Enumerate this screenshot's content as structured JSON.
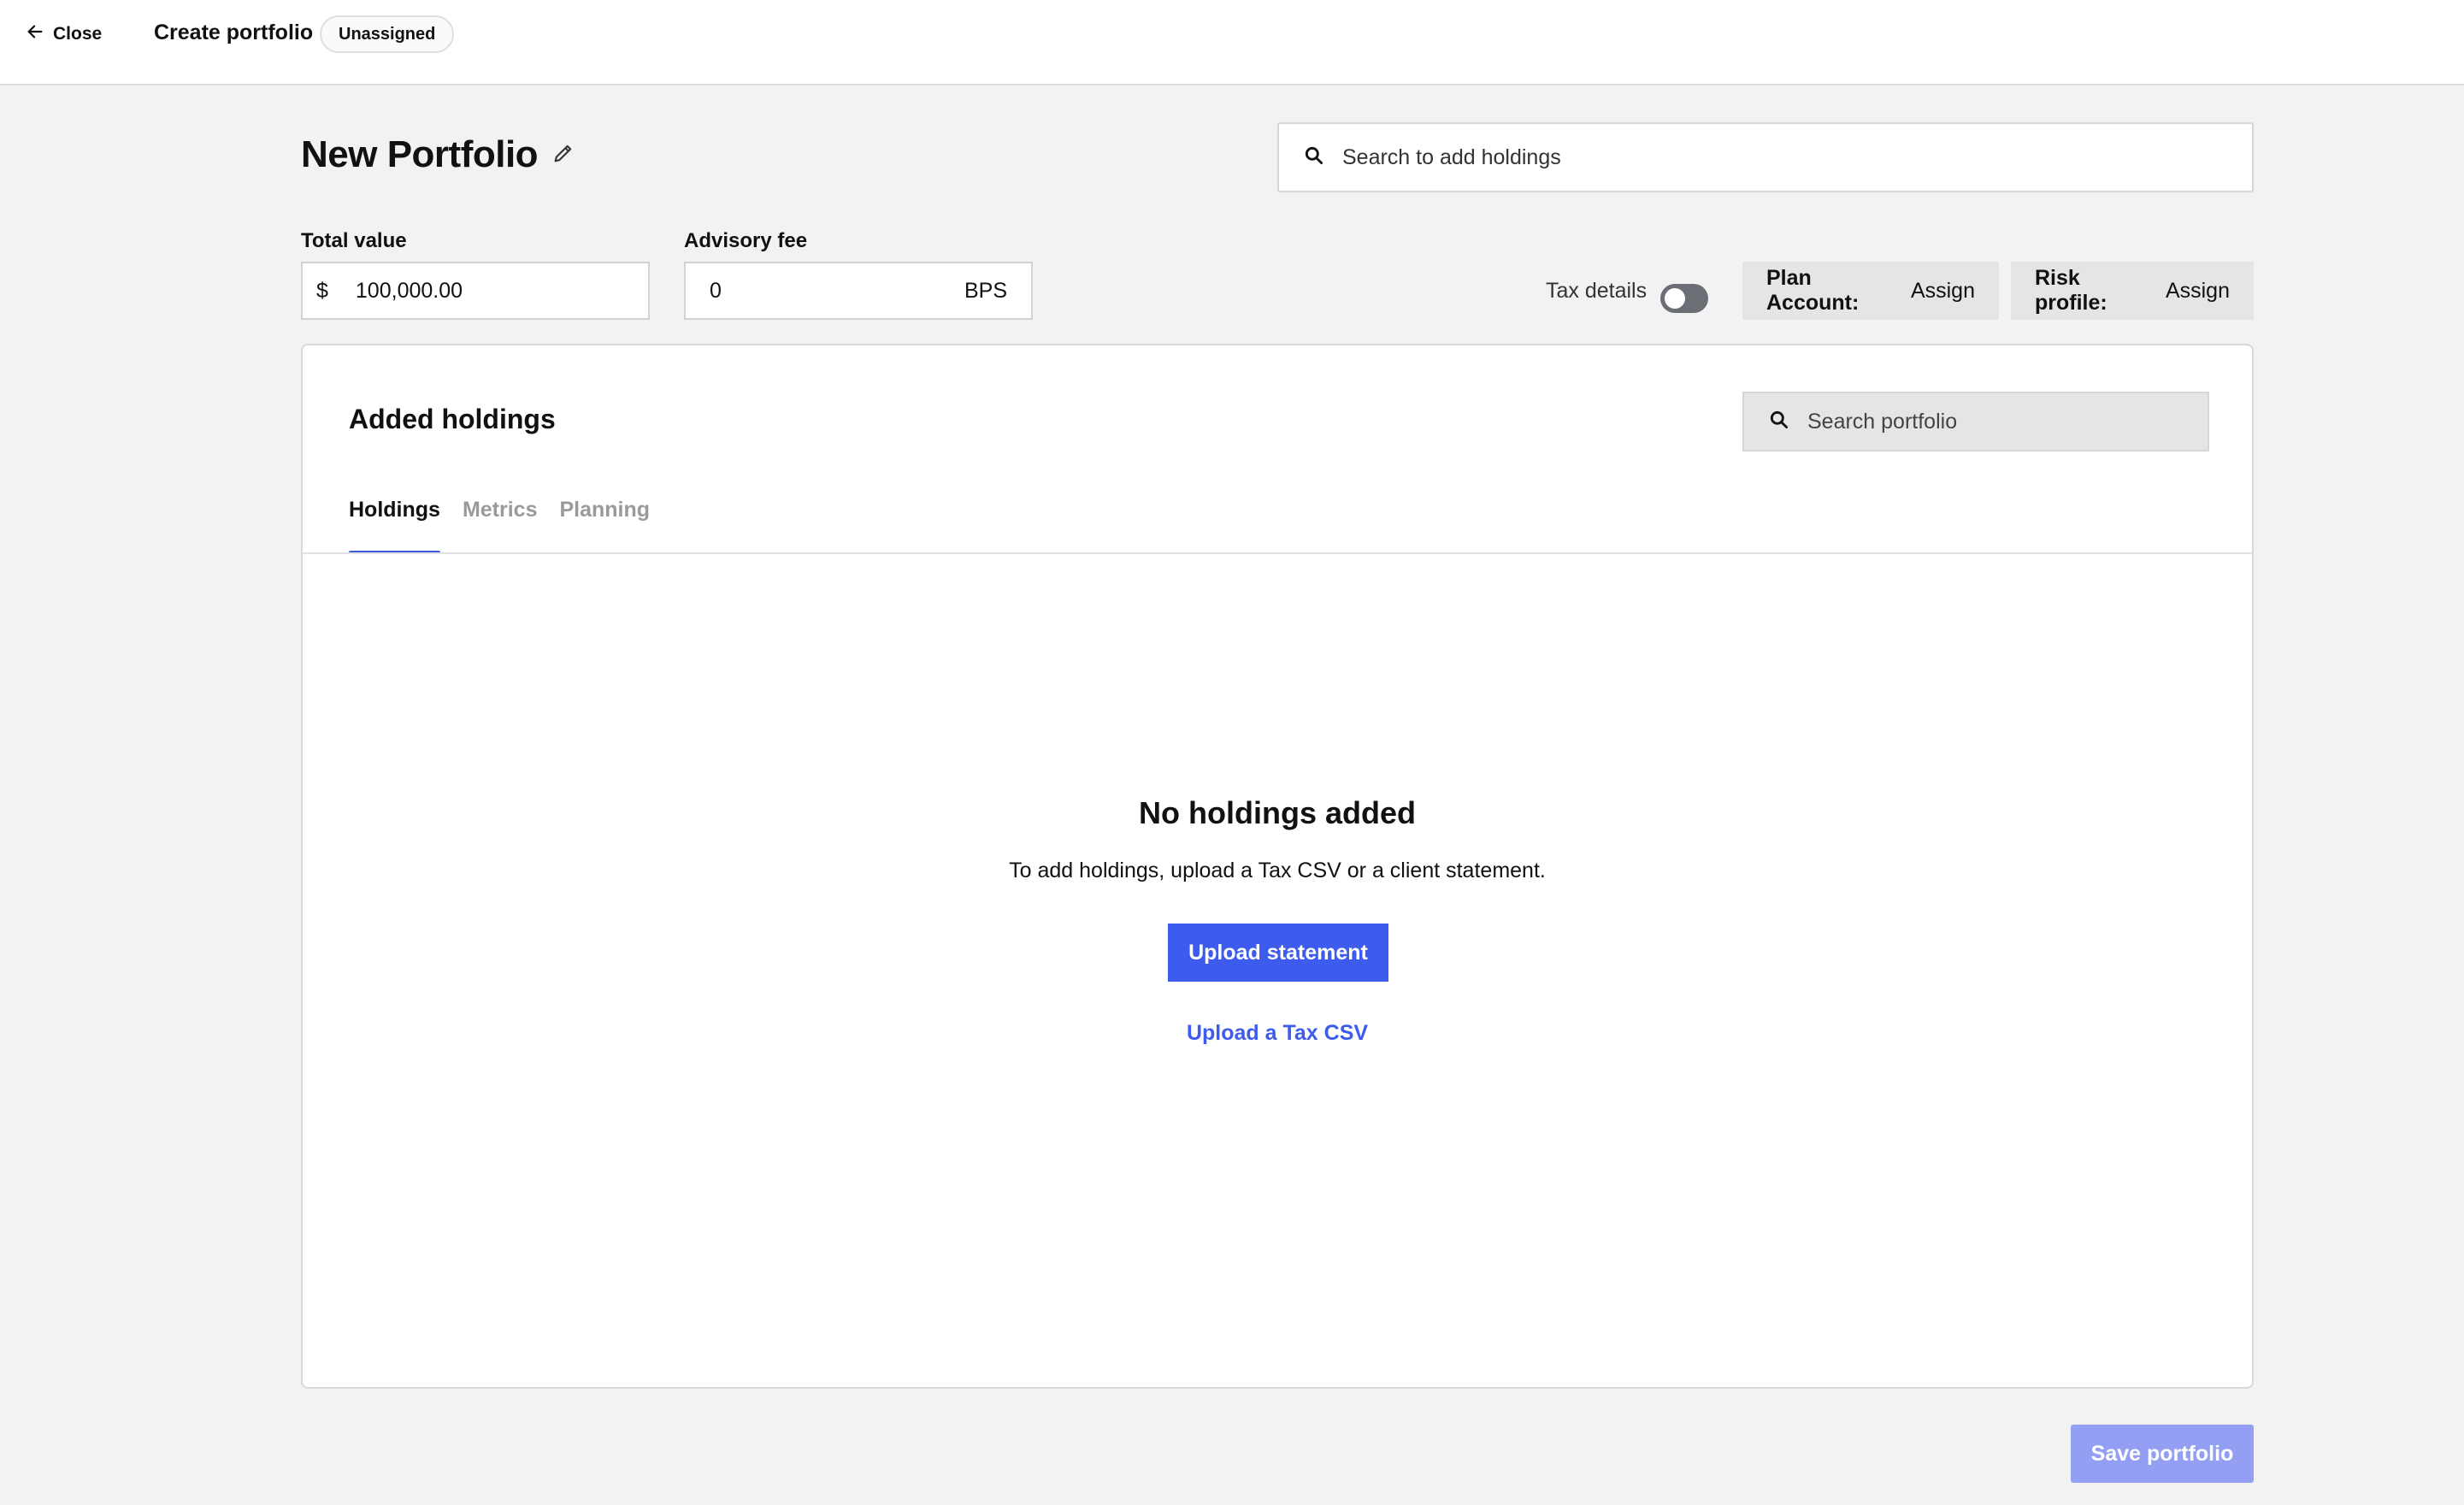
{
  "topbar": {
    "close_label": "Close",
    "title": "Create portfolio",
    "status": "Unassigned"
  },
  "page": {
    "title": "New Portfolio",
    "search_placeholder": "Search to add holdings"
  },
  "fields": {
    "total_value": {
      "label": "Total value",
      "prefix": "$",
      "value": "100,000.00"
    },
    "advisory_fee": {
      "label": "Advisory fee",
      "value": "0",
      "suffix": "BPS"
    }
  },
  "options": {
    "tax_details_label": "Tax details",
    "tax_details_enabled": false,
    "plan_account": {
      "key": "Plan Account:",
      "value": "Assign"
    },
    "risk_profile": {
      "key": "Risk profile:",
      "value": "Assign"
    }
  },
  "holdings_card": {
    "title": "Added holdings",
    "search_placeholder": "Search portfolio",
    "tabs": [
      {
        "label": "Holdings",
        "active": true
      },
      {
        "label": "Metrics",
        "active": false
      },
      {
        "label": "Planning",
        "active": false
      }
    ],
    "empty": {
      "title": "No holdings added",
      "subtitle": "To add holdings, upload a Tax CSV or a client statement.",
      "primary_action": "Upload statement",
      "secondary_action": "Upload a Tax CSV"
    }
  },
  "footer": {
    "save_label": "Save portfolio"
  },
  "colors": {
    "accent": "#3d5bec",
    "accent_disabled": "#929ff2",
    "background": "#f2f2f2"
  }
}
